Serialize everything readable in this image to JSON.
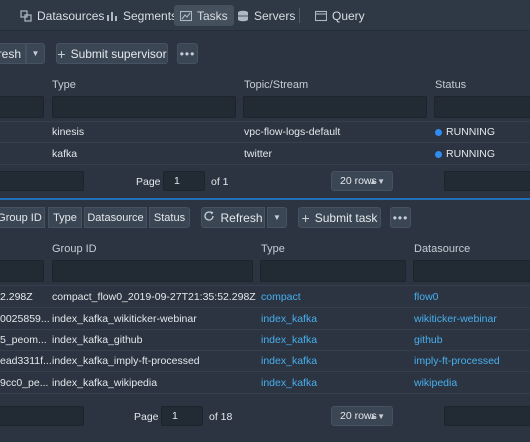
{
  "nav": {
    "items": [
      {
        "label": "Datasources",
        "icon": "datasources-icon"
      },
      {
        "label": "Segments",
        "icon": "segments-icon"
      },
      {
        "label": "Tasks",
        "icon": "tasks-icon"
      },
      {
        "label": "Servers",
        "icon": "servers-icon"
      },
      {
        "label": "Query",
        "icon": "query-icon"
      }
    ],
    "active": "Tasks"
  },
  "supervisors": {
    "refresh_label": "resh",
    "submit_label": "Submit supervisor",
    "columns": [
      "Type",
      "Topic/Stream",
      "Status"
    ],
    "rows": [
      {
        "type": "kinesis",
        "topic": "vpc-flow-logs-default",
        "status": "RUNNING"
      },
      {
        "type": "kafka",
        "topic": "twitter",
        "status": "RUNNING"
      }
    ],
    "pager": {
      "page_label": "Page",
      "page": "1",
      "of_label": "of 1",
      "rows_label": "20 rows"
    }
  },
  "tasks": {
    "group_buttons": [
      "Group ID",
      "Type",
      "Datasource",
      "Status"
    ],
    "refresh_label": "Refresh",
    "submit_label": "Submit task",
    "columns": [
      "Group ID",
      "Type",
      "Datasource"
    ],
    "rows": [
      {
        "id": "2.298Z",
        "group": "compact_flow0_2019-09-27T21:35:52.298Z",
        "type": "compact",
        "datasource": "flow0"
      },
      {
        "id": "0025859...",
        "group": "index_kafka_wikiticker-webinar",
        "type": "index_kafka",
        "datasource": "wikiticker-webinar"
      },
      {
        "id": "5_peom...",
        "group": "index_kafka_github",
        "type": "index_kafka",
        "datasource": "github"
      },
      {
        "id": "ead3311f...",
        "group": "index_kafka_imply-ft-processed",
        "type": "index_kafka",
        "datasource": "imply-ft-processed"
      },
      {
        "id": "9cc0_pe...",
        "group": "index_kafka_wikipedia",
        "type": "index_kafka",
        "datasource": "wikipedia"
      }
    ],
    "pager": {
      "page_label": "Page",
      "page": "1",
      "of_label": "of 18",
      "rows_label": "20 rows"
    }
  },
  "colors": {
    "accent": "#48aff0",
    "running": "#2f8cf0",
    "background": "#2b3440"
  }
}
